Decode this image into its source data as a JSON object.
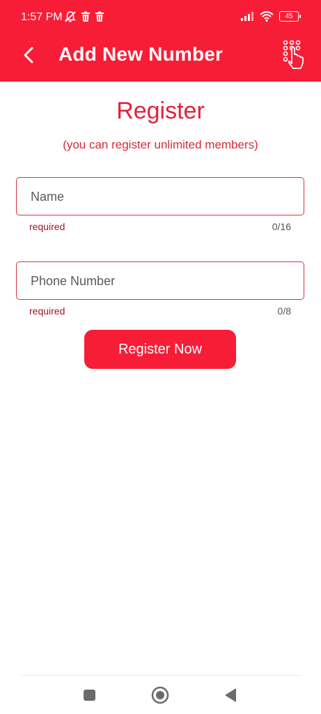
{
  "status_bar": {
    "time": "1:57 PM",
    "battery": "45",
    "icons": [
      "muted-bell-icon",
      "trash-icon",
      "trash-icon",
      "signal-icon",
      "wifi-icon",
      "battery-icon"
    ]
  },
  "app_bar": {
    "title": "Add New Number",
    "back_icon": "chevron-left-icon",
    "action_icon": "dialpad-touch-icon"
  },
  "form": {
    "heading": "Register",
    "subheading": "(you can register unlimited members)",
    "name": {
      "placeholder": "Name",
      "value": "",
      "helper": "required",
      "counter": "0/16"
    },
    "phone": {
      "placeholder": "Phone Number",
      "value": "",
      "helper": "required",
      "counter": "0/8"
    },
    "submit_label": "Register Now"
  },
  "nav_bar": {
    "items": [
      "recent-apps-icon",
      "home-icon",
      "back-icon"
    ]
  },
  "colors": {
    "primary": "#f81d36",
    "accent_text": "#e02239",
    "helper_text": "#a3141f"
  }
}
